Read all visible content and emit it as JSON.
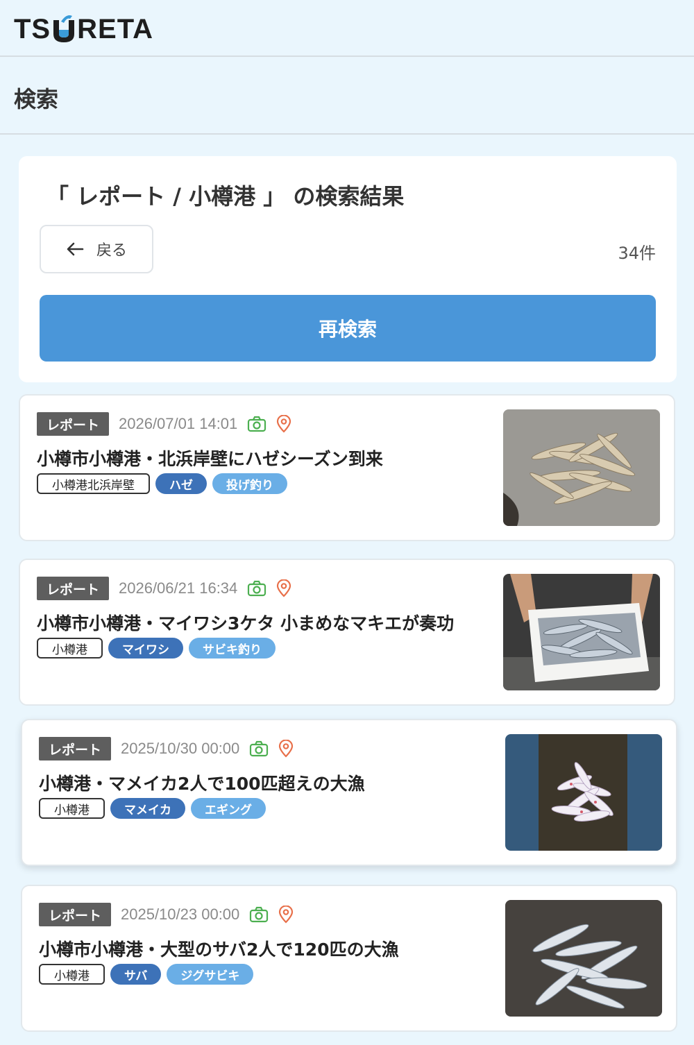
{
  "header": {
    "logo_text_left": "TS",
    "logo_text_right": "RETA"
  },
  "page": {
    "title": "検索"
  },
  "search": {
    "heading": "「 レポート / 小樽港 」 の検索結果",
    "back_label": "戻る",
    "count": "34件",
    "research_label": "再検索"
  },
  "reports": [
    {
      "type": "レポート",
      "date": "2026/07/01 14:01",
      "title": "小樽市小樽港・北浜岸壁にハゼシーズン到来",
      "tags": {
        "place": "小樽港北浜岸壁",
        "fish": "ハゼ",
        "method": "投げ釣り"
      }
    },
    {
      "type": "レポート",
      "date": "2026/06/21 16:34",
      "title": "小樽市小樽港・マイワシ3ケタ 小まめなマキエが奏功",
      "tags": {
        "place": "小樽港",
        "fish": "マイワシ",
        "method": "サビキ釣り"
      }
    },
    {
      "type": "レポート",
      "date": "2025/10/30 00:00",
      "title": "小樽港・マメイカ2人で100匹超えの大漁",
      "tags": {
        "place": "小樽港",
        "fish": "マメイカ",
        "method": "エギング"
      }
    },
    {
      "type": "レポート",
      "date": "2025/10/23 00:00",
      "title": "小樽市小樽港・大型のサバ2人で120匹の大漁",
      "tags": {
        "place": "小樽港",
        "fish": "サバ",
        "method": "ジグサビキ"
      }
    }
  ],
  "icons": {
    "photo": "camera-icon",
    "location": "location-pin-icon",
    "back": "arrow-left-icon"
  },
  "colors": {
    "accent": "#4a96d9",
    "fish_tag": "#3d72b8",
    "method_tag": "#6aaee6",
    "camera": "#4caf50",
    "pin": "#e8704a"
  }
}
